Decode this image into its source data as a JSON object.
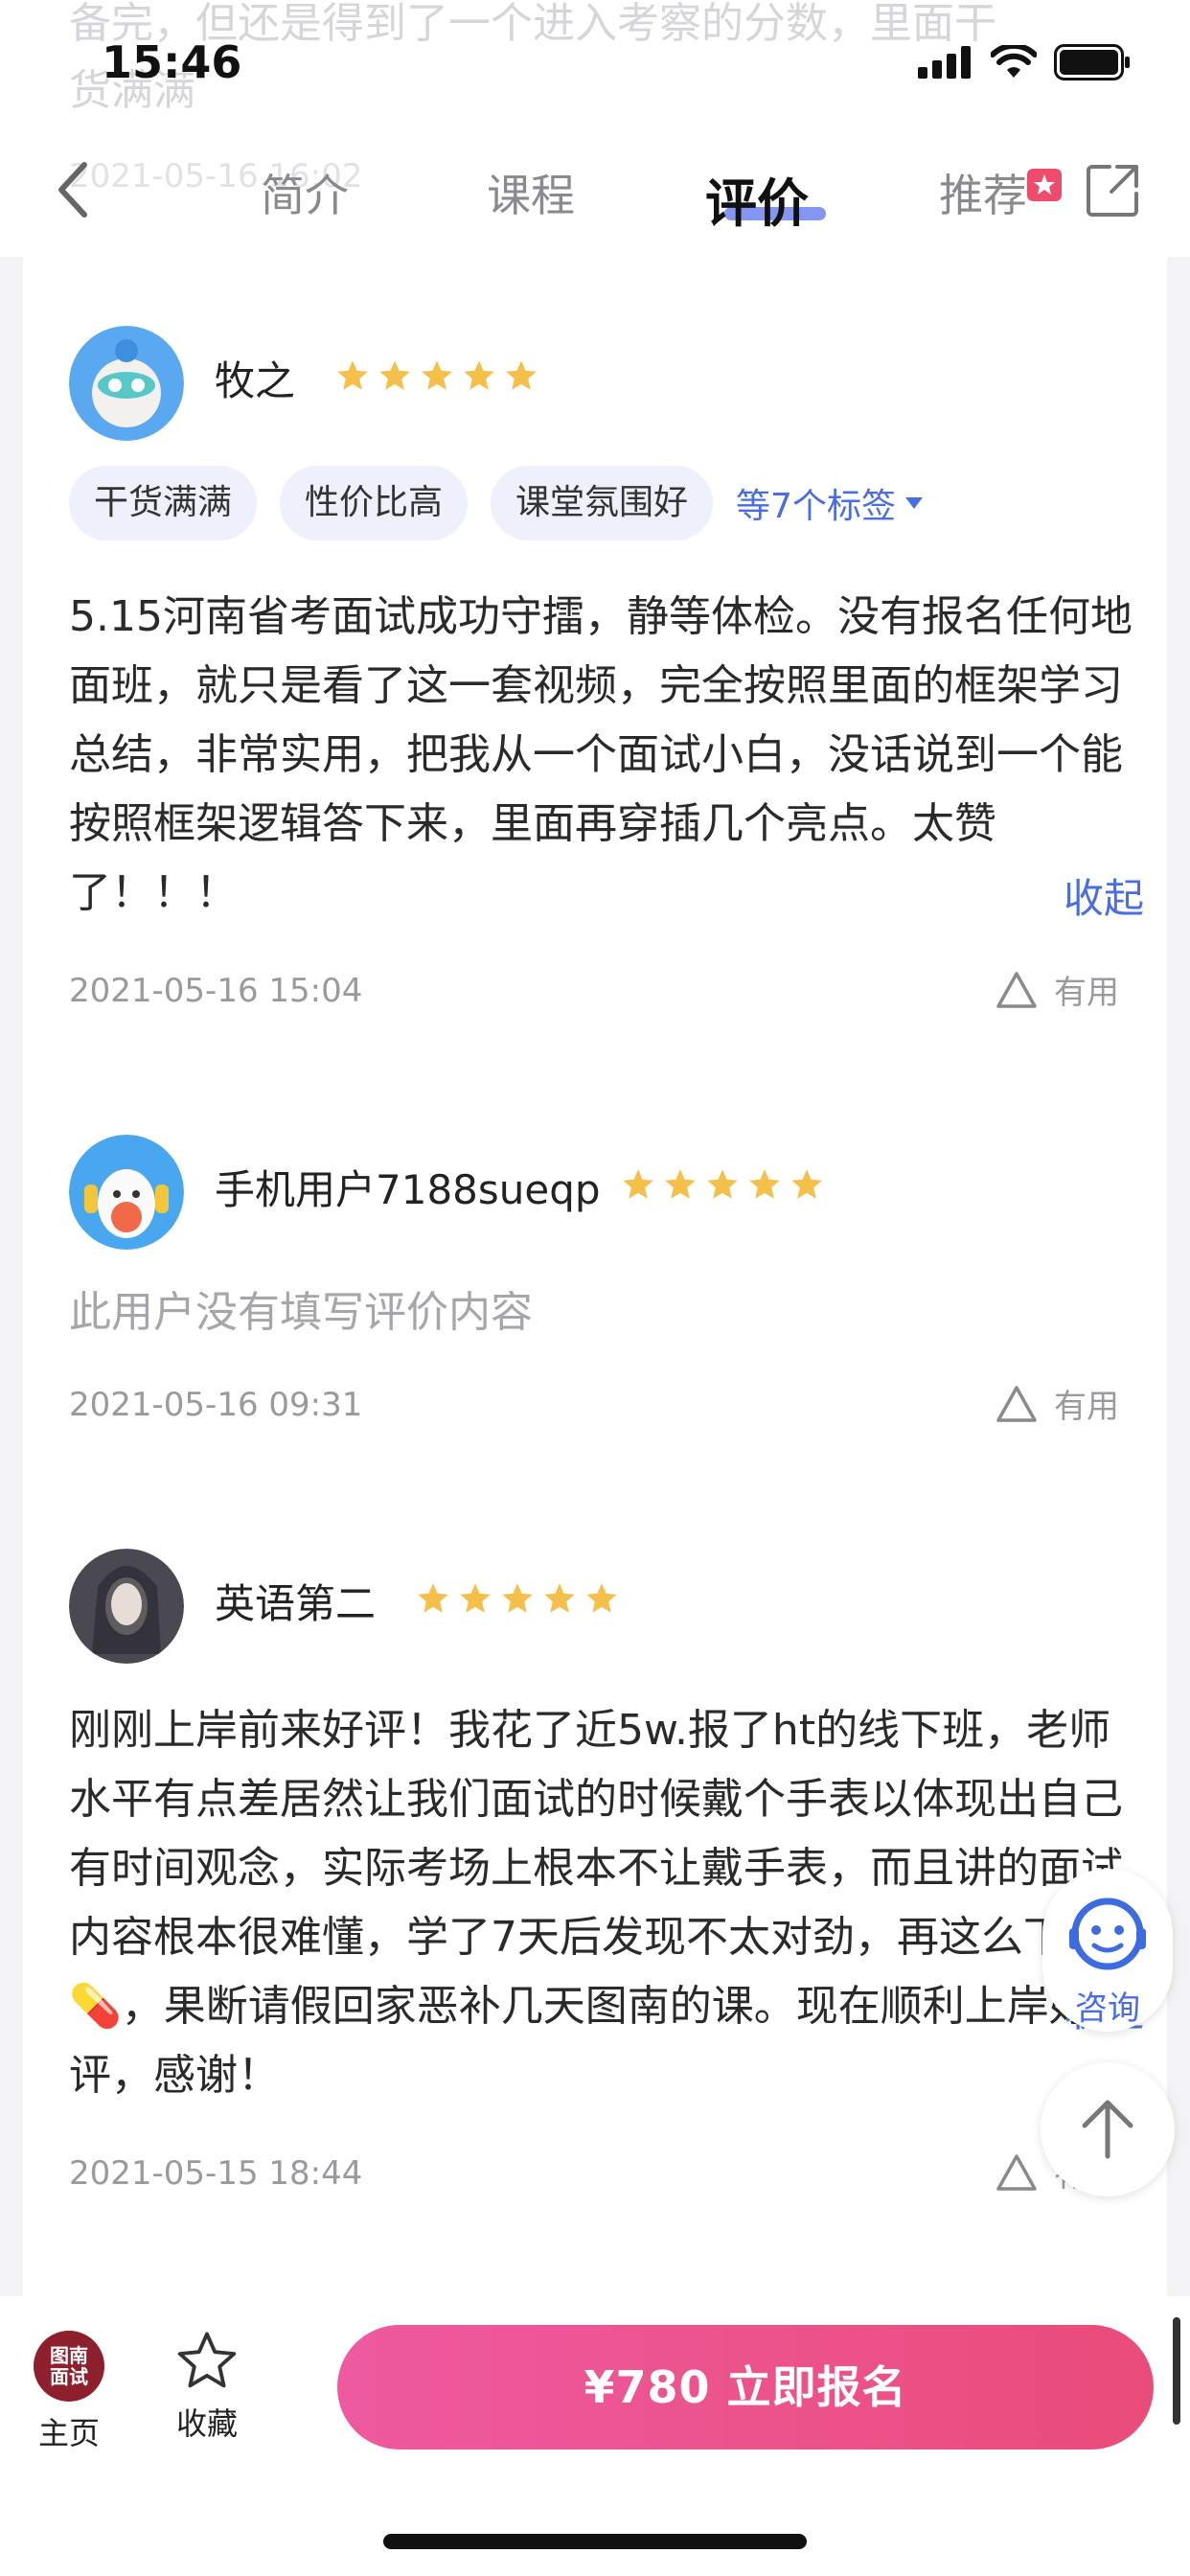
{
  "status_bar": {
    "time": "15:46"
  },
  "background_ghost": {
    "line1": "备完，但还是得到了一个进入考察的分数，里面干",
    "line2": "货满满",
    "line3": "2021-05-16 16:02"
  },
  "nav": {
    "tabs": [
      {
        "label": "简介"
      },
      {
        "label": "课程"
      },
      {
        "label": "评价"
      },
      {
        "label": "推荐"
      }
    ],
    "active_tab": "评价"
  },
  "reviews": [
    {
      "username": "牧之",
      "rating": 5,
      "tags": [
        "干货满满",
        "性价比高",
        "课堂氛围好"
      ],
      "more_tags": "等7个标签",
      "text": "5.15河南省考面试成功守擂，静等体检。没有报名任何地面班，就只是看了这一套视频，完全按照里面的框架学习总结，非常实用，把我从一个面试小白，没话说到一个能按照框架逻辑答下来，里面再穿插几个亮点。太赞了！！！",
      "collapse_label": "收起",
      "date": "2021-05-16 15:04",
      "useful_label": "有用"
    },
    {
      "username": "手机用户7188sueqp",
      "rating": 5,
      "text": "此用户没有填写评价内容",
      "date": "2021-05-16 09:31",
      "useful_label": "有用"
    },
    {
      "username": "英语第二",
      "rating": 5,
      "text": "刚刚上岸前来好评！我花了近5w.报了ht的线下班，老师水平有点差居然让我们面试的时候戴个手表以体现出自己有时间观念，实际考场上根本不让戴手表，而且讲的面试内容根本很难懂，学了7天后发现不太对劲，再这么下去💊，果断请假回家恶补几天图南的课。现在顺利上岸好评，感谢！",
      "collapse_label": "收起",
      "date": "2021-05-15 18:44",
      "useful_label": "有用"
    }
  ],
  "floating": {
    "consult_label": "咨询"
  },
  "bottom_bar": {
    "logo_text_1": "图南",
    "logo_text_2": "面试",
    "home_label": "主页",
    "favorite_label": "收藏",
    "cta_label": "¥780  立即报名"
  },
  "colors": {
    "accent": "#4a6ee0",
    "star": "#f5c04a",
    "cta_gradient_start": "#ee5aa0",
    "cta_gradient_end": "#ea4c7a",
    "logo_bg": "#8e1f2c"
  }
}
